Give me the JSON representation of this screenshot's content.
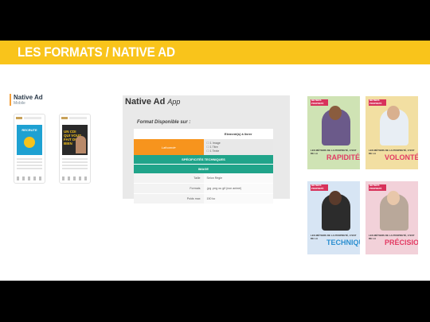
{
  "banner": {
    "title": "LES FORMATS / NATIVE AD"
  },
  "left_label": {
    "title": "Native Ad",
    "subtitle": "Mobile"
  },
  "phones": [
    {
      "ad_text": "RECRUTE",
      "style": "blue"
    },
    {
      "ad_text": "UN CDI QUI VOUS FAIT DU BIEN",
      "style": "dark"
    }
  ],
  "panel": {
    "title": "Native Ad",
    "title_suffix": "App",
    "format_label": "Format Disponible sur :",
    "element_header": "Element(s) à livrer",
    "label_cell": "Lafourmie",
    "options": [
      "☐ 1 Image",
      "☐ 1 Titre",
      "☐ 1 Texte"
    ],
    "specs_header": "SPÉCIFICITÉS TECHNIQUES",
    "image_header": "IMAGE",
    "rows": [
      {
        "key": "Taille",
        "value": "Selon Règle"
      },
      {
        "key": "Formats",
        "value": ".jpg .png ou gif (non animé)"
      },
      {
        "key": "Poids max",
        "value": "150 ko"
      }
    ]
  },
  "posters": [
    {
      "tag": "MÉTIERS PROPRETÉ",
      "caption": "LES MÉTIERS DE LA PROPRETÉ, C'EST DE LA",
      "word": "RAPIDITÉ"
    },
    {
      "tag": "MÉTIERS PROPRETÉ",
      "caption": "LES MÉTIERS DE LA PROPRETÉ, C'EST DE LA",
      "word": "VOLONTÉ"
    },
    {
      "tag": "MÉTIERS PROPRETÉ",
      "caption": "LES MÉTIERS DE LA PROPRETÉ, C'EST DE LA",
      "word": "TECHNIQUE"
    },
    {
      "tag": "MÉTIERS PROPRETÉ",
      "caption": "LES MÉTIERS DE LA PROPRETÉ, C'EST DE LA",
      "word": "PRÉCISION"
    }
  ],
  "colors": {
    "banner": "#f9c41b",
    "accent_orange": "#f7941d",
    "accent_green": "#20a48a",
    "poster_word": "#e23b63"
  }
}
